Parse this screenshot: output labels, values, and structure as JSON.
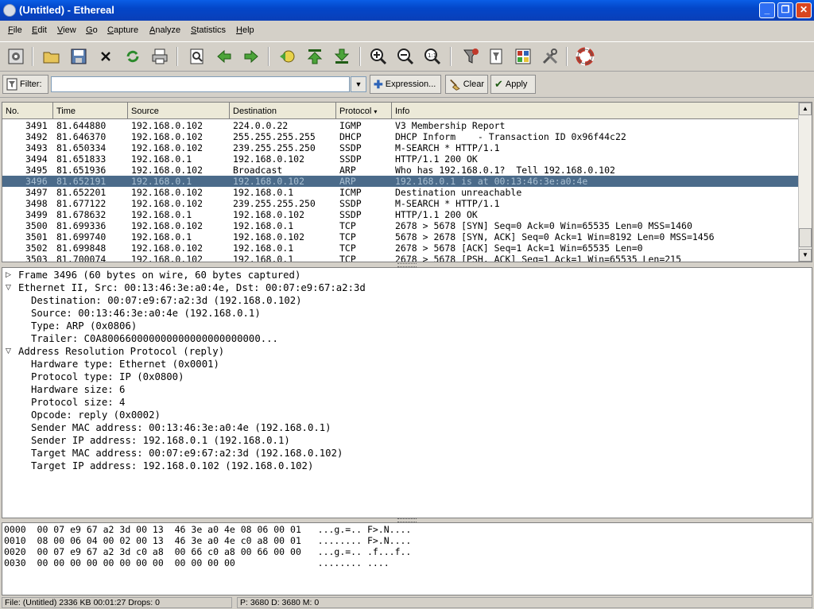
{
  "window": {
    "title": "(Untitled) - Ethereal"
  },
  "menu": [
    "File",
    "Edit",
    "View",
    "Go",
    "Capture",
    "Analyze",
    "Statistics",
    "Help"
  ],
  "menu_underline": [
    "F",
    "E",
    "V",
    "G",
    "C",
    "A",
    "S",
    "H"
  ],
  "filter": {
    "label": "Filter:",
    "value": "",
    "expression": "Expression...",
    "clear": "Clear",
    "apply": "Apply"
  },
  "columns": [
    "No.",
    "Time",
    "Source",
    "Destination",
    "Protocol",
    "Info"
  ],
  "packets": [
    {
      "no": "3491",
      "time": "81.644880",
      "src": "192.168.0.102",
      "dst": "224.0.0.22",
      "proto": "IGMP",
      "info": "V3 Membership Report"
    },
    {
      "no": "3492",
      "time": "81.646370",
      "src": "192.168.0.102",
      "dst": "255.255.255.255",
      "proto": "DHCP",
      "info": "DHCP Inform    - Transaction ID 0x96f44c22"
    },
    {
      "no": "3493",
      "time": "81.650334",
      "src": "192.168.0.102",
      "dst": "239.255.255.250",
      "proto": "SSDP",
      "info": "M-SEARCH * HTTP/1.1"
    },
    {
      "no": "3494",
      "time": "81.651833",
      "src": "192.168.0.1",
      "dst": "192.168.0.102",
      "proto": "SSDP",
      "info": "HTTP/1.1 200 OK"
    },
    {
      "no": "3495",
      "time": "81.651936",
      "src": "192.168.0.102",
      "dst": "Broadcast",
      "proto": "ARP",
      "info": "Who has 192.168.0.1?  Tell 192.168.0.102"
    },
    {
      "no": "3496",
      "time": "81.652191",
      "src": "192.168.0.1",
      "dst": "192.168.0.102",
      "proto": "ARP",
      "info": "192.168.0.1 is at 00:13:46:3e:a0:4e",
      "selected": true
    },
    {
      "no": "3497",
      "time": "81.652201",
      "src": "192.168.0.102",
      "dst": "192.168.0.1",
      "proto": "ICMP",
      "info": "Destination unreachable"
    },
    {
      "no": "3498",
      "time": "81.677122",
      "src": "192.168.0.102",
      "dst": "239.255.255.250",
      "proto": "SSDP",
      "info": "M-SEARCH * HTTP/1.1"
    },
    {
      "no": "3499",
      "time": "81.678632",
      "src": "192.168.0.1",
      "dst": "192.168.0.102",
      "proto": "SSDP",
      "info": "HTTP/1.1 200 OK"
    },
    {
      "no": "3500",
      "time": "81.699336",
      "src": "192.168.0.102",
      "dst": "192.168.0.1",
      "proto": "TCP",
      "info": "2678 > 5678 [SYN] Seq=0 Ack=0 Win=65535 Len=0 MSS=1460"
    },
    {
      "no": "3501",
      "time": "81.699740",
      "src": "192.168.0.1",
      "dst": "192.168.0.102",
      "proto": "TCP",
      "info": "5678 > 2678 [SYN, ACK] Seq=0 Ack=1 Win=8192 Len=0 MSS=1456"
    },
    {
      "no": "3502",
      "time": "81.699848",
      "src": "192.168.0.102",
      "dst": "192.168.0.1",
      "proto": "TCP",
      "info": "2678 > 5678 [ACK] Seq=1 Ack=1 Win=65535 Len=0"
    },
    {
      "no": "3503",
      "time": "81.700074",
      "src": "192.168.0.102",
      "dst": "192.168.0.1",
      "proto": "TCP",
      "info": "2678 > 5678 [PSH, ACK] Seq=1 Ack=1 Win=65535 Len=215"
    }
  ],
  "detail": [
    {
      "text": "Frame 3496 (60 bytes on wire, 60 bytes captured)",
      "level": 0,
      "toggle": "collapsed"
    },
    {
      "text": "Ethernet II, Src: 00:13:46:3e:a0:4e, Dst: 00:07:e9:67:a2:3d",
      "level": 0,
      "toggle": "expanded"
    },
    {
      "text": "Destination: 00:07:e9:67:a2:3d (192.168.0.102)",
      "level": 1
    },
    {
      "text": "Source: 00:13:46:3e:a0:4e (192.168.0.1)",
      "level": 1
    },
    {
      "text": "Type: ARP (0x0806)",
      "level": 1
    },
    {
      "text": "Trailer: C0A800660000000000000000000000...",
      "level": 1
    },
    {
      "text": "Address Resolution Protocol (reply)",
      "level": 0,
      "toggle": "expanded"
    },
    {
      "text": "Hardware type: Ethernet (0x0001)",
      "level": 1
    },
    {
      "text": "Protocol type: IP (0x0800)",
      "level": 1
    },
    {
      "text": "Hardware size: 6",
      "level": 1
    },
    {
      "text": "Protocol size: 4",
      "level": 1
    },
    {
      "text": "Opcode: reply (0x0002)",
      "level": 1
    },
    {
      "text": "Sender MAC address: 00:13:46:3e:a0:4e (192.168.0.1)",
      "level": 1
    },
    {
      "text": "Sender IP address: 192.168.0.1 (192.168.0.1)",
      "level": 1
    },
    {
      "text": "Target MAC address: 00:07:e9:67:a2:3d (192.168.0.102)",
      "level": 1
    },
    {
      "text": "Target IP address: 192.168.0.102 (192.168.0.102)",
      "level": 1
    }
  ],
  "hex": [
    "0000  00 07 e9 67 a2 3d 00 13  46 3e a0 4e 08 06 00 01   ...g.=.. F>.N....",
    "0010  08 00 06 04 00 02 00 13  46 3e a0 4e c0 a8 00 01   ........ F>.N....",
    "0020  00 07 e9 67 a2 3d c0 a8  00 66 c0 a8 00 66 00 00   ...g.=.. .f...f..",
    "0030  00 00 00 00 00 00 00 00  00 00 00 00               ........ ...."
  ],
  "status": {
    "left": "File: (Untitled) 2336 KB 00:01:27 Drops: 0",
    "right": "P: 3680 D: 3680 M: 0"
  },
  "colors": {
    "title_bar": "#0a4fd6",
    "selected_row": "#4b6b8a",
    "chrome": "#d4d0c8"
  },
  "toolbar_icons": [
    "capture-options-icon",
    "open-icon",
    "save-icon",
    "close-file-icon",
    "reload-icon",
    "print-icon",
    "find-packet-icon",
    "go-back-icon",
    "go-forward-icon",
    "go-to-packet-icon",
    "go-first-icon",
    "go-last-icon",
    "zoom-in-icon",
    "zoom-out-icon",
    "zoom-normal-icon",
    "capture-filters-icon",
    "display-filters-icon",
    "coloring-rules-icon",
    "preferences-icon",
    "help-icon"
  ]
}
